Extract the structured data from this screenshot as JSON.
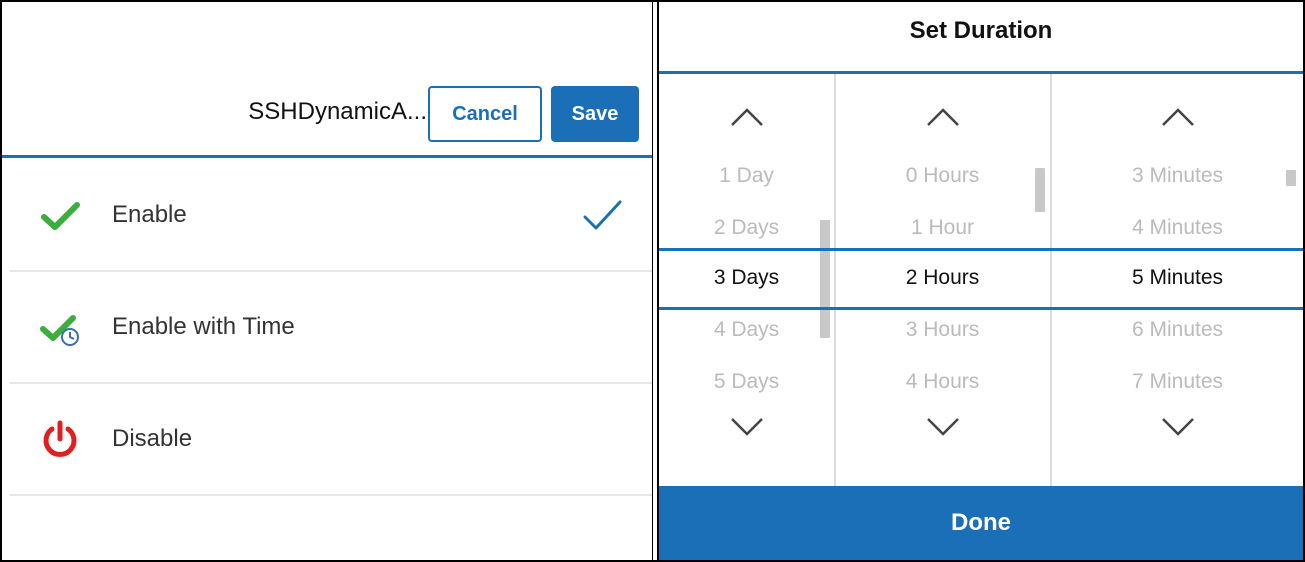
{
  "left_panel": {
    "title": "SSHDynamicA...",
    "cancel_label": "Cancel",
    "save_label": "Save",
    "options": [
      {
        "label": "Enable",
        "icon": "green-check-icon",
        "selected": true
      },
      {
        "label": "Enable with Time",
        "icon": "check-clock-icon",
        "selected": false
      },
      {
        "label": "Disable",
        "icon": "power-icon",
        "selected": false
      }
    ]
  },
  "right_panel": {
    "title": "Set Duration",
    "days": [
      "1 Day",
      "2 Days",
      "3 Days",
      "4 Days",
      "5 Days"
    ],
    "hours": [
      "0 Hours",
      "1 Hour",
      "2 Hours",
      "3 Hours",
      "4 Hours"
    ],
    "minutes": [
      "3 Minutes",
      "4 Minutes",
      "5 Minutes",
      "6 Minutes",
      "7 Minutes"
    ],
    "selected": {
      "days": "3 Days",
      "hours": "2 Hours",
      "minutes": "5 Minutes"
    },
    "done_label": "Done"
  },
  "colors": {
    "accent": "#1b6fb6",
    "check_green": "#3cae3c",
    "power_red": "#e02020"
  }
}
